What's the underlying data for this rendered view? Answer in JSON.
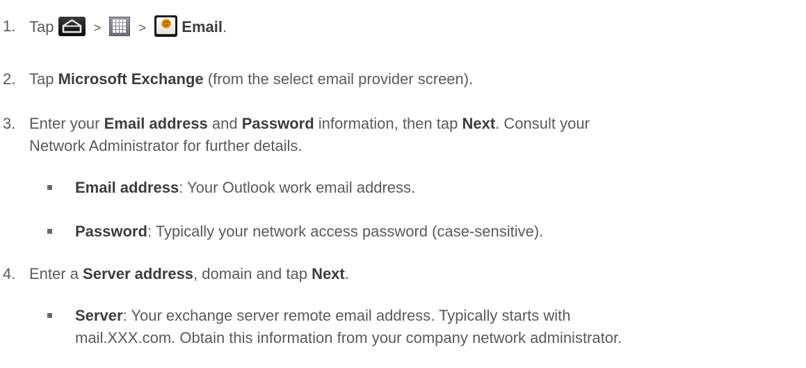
{
  "steps": [
    {
      "number": "1.",
      "tap": "Tap",
      "sep1": ">",
      "sep2": ">",
      "email_label": "Email",
      "end": ".",
      "icons": [
        "home-icon",
        "apps-icon",
        "email-icon"
      ]
    },
    {
      "number": "2.",
      "pre": "Tap ",
      "bold": "Microsoft Exchange",
      "post": " (from the select email provider screen)."
    },
    {
      "number": "3.",
      "line1_pre": "Enter your ",
      "bold1": "Email address",
      "mid1": " and ",
      "bold2": "Password",
      "mid2": " information, then tap ",
      "bold3": "Next",
      "line1_post": ". Consult your",
      "line2": "Network Administrator for further details.",
      "bullets": [
        {
          "bold": "Email address",
          "text": ": Your Outlook work email address."
        },
        {
          "bold": "Password",
          "text": ": Typically your network access password (case-sensitive)."
        }
      ]
    },
    {
      "number": "4.",
      "pre": "Enter a ",
      "bold1": "Server address",
      "mid": ", domain and tap ",
      "bold2": "Next",
      "post": ".",
      "bullets": [
        {
          "bold": "Server",
          "text": ": Your exchange server remote email address. Typically starts with",
          "line2": "mail.XXX.com. Obtain this information from your company network administrator."
        }
      ]
    }
  ],
  "colors": {
    "text": "#5a5a5a",
    "bold_text": "#3d3d3d",
    "email_badge": "#f2a21d"
  }
}
